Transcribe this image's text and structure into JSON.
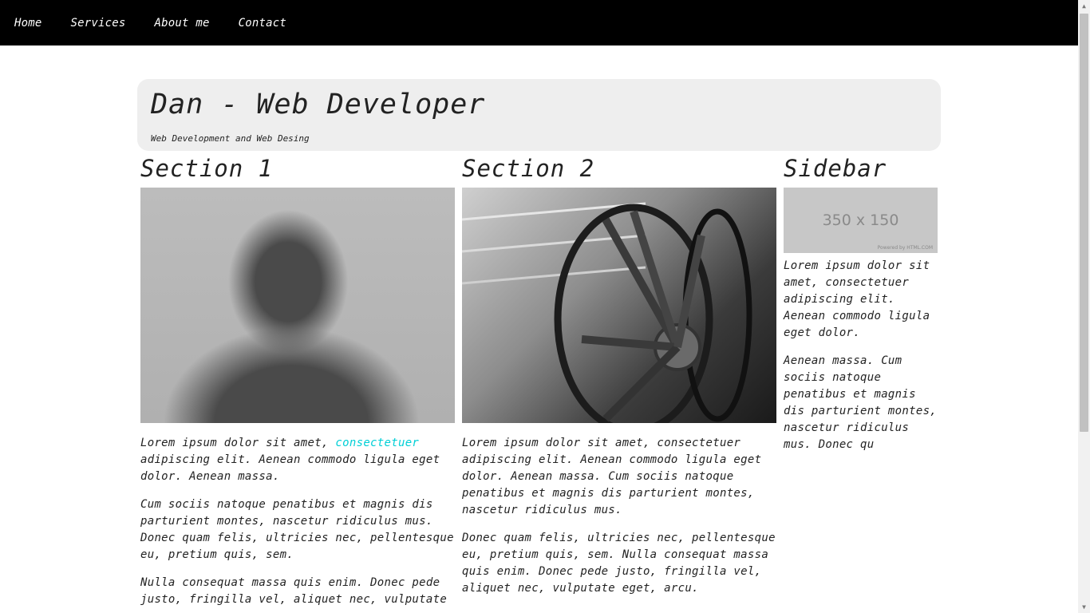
{
  "nav": {
    "items": [
      {
        "label": "Home"
      },
      {
        "label": "Services"
      },
      {
        "label": "About me"
      },
      {
        "label": "Contact"
      }
    ]
  },
  "header": {
    "title": "Dan - Web Developer",
    "subtitle": "Web Development and Web Desing"
  },
  "section1": {
    "title": "Section 1",
    "p1_before_link": "Lorem ipsum dolor sit amet, ",
    "p1_link": "consectetuer",
    "p1_after_link": " adipiscing elit. Aenean commodo ligula eget dolor. Aenean massa.",
    "p2": "Cum sociis natoque penatibus et magnis dis parturient montes, nascetur ridiculus mus. Donec quam felis, ultricies nec, pellentesque eu, pretium quis, sem.",
    "p3": "Nulla consequat massa quis enim. Donec pede justo, fringilla vel, aliquet nec, vulputate"
  },
  "section2": {
    "title": "Section 2",
    "p1": "Lorem ipsum dolor sit amet, consectetuer adipiscing elit. Aenean commodo ligula eget dolor. Aenean massa. Cum sociis natoque penatibus et magnis dis parturient montes, nascetur ridiculus mus.",
    "p2": "Donec quam felis, ultricies nec, pellentesque eu, pretium quis, sem. Nulla consequat massa quis enim. Donec pede justo, fringilla vel, aliquet nec, vulputate eget, arcu."
  },
  "sidebar": {
    "title": "Sidebar",
    "placeholder_text": "350 x 150",
    "placeholder_powered": "Powered by HTML.COM",
    "p1": "Lorem ipsum dolor sit amet, consectetuer adipiscing elit. Aenean commodo ligula eget dolor.",
    "p2": "Aenean massa. Cum sociis natoque penatibus et magnis dis parturient montes, nascetur ridiculus mus. Donec qu"
  },
  "colors": {
    "navbar_bg": "#000000",
    "header_bg": "#eeeeee",
    "link": "#00cfd6"
  }
}
